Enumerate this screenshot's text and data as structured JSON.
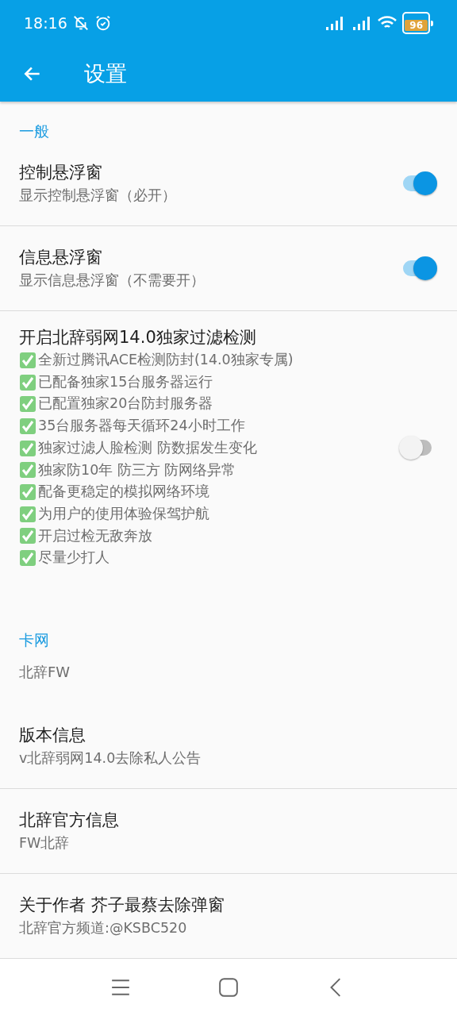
{
  "status_bar": {
    "time": "18:16",
    "battery": "96"
  },
  "app_bar": {
    "title": "设置"
  },
  "preferences": [
    {
      "kind": "category",
      "title": "一般"
    },
    {
      "kind": "switch",
      "title": "控制悬浮窗",
      "summary": "显示控制悬浮窗（必开）",
      "on": true,
      "divider": true
    },
    {
      "kind": "switch",
      "title": "信息悬浮窗",
      "summary": "显示信息悬浮窗（不需要开）",
      "on": true,
      "divider": true
    },
    {
      "kind": "switch",
      "title": "开启北辞弱网14.0独家过滤检测",
      "on": false,
      "divider": false,
      "lines": [
        "全新过腾讯ACE检测防封(14.0独家专属)",
        "已配备独家15台服务器运行",
        "已配置独家20台防封服务器",
        "35台服务器每天循环24小时工作",
        "独家过滤人脸检测 防数据发生变化",
        "独家防10年 防三方 防网络异常",
        "配备更稳定的模拟网络环境",
        "为用户的使用体验保驾护航",
        "开启过检无敌奔放",
        "尽量少打人"
      ]
    },
    {
      "kind": "category",
      "title": "卡网"
    },
    {
      "kind": "plain",
      "summary": "北辞FW",
      "divider": false
    },
    {
      "kind": "text",
      "title": "版本信息",
      "summary": "v北辞弱网14.0去除私人公告",
      "divider": true
    },
    {
      "kind": "text",
      "title": "北辞官方信息",
      "summary": "FW北辞",
      "divider": true
    },
    {
      "kind": "text",
      "title": "关于作者 芥子最蔡去除弹窗",
      "summary": "北辞官方频道:@KSBC520",
      "divider": true
    }
  ]
}
